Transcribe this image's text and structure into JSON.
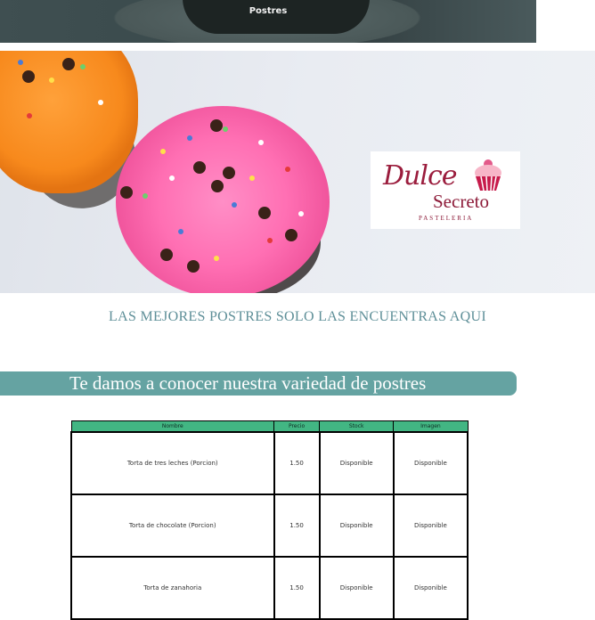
{
  "top_strip": {
    "label": "Postres"
  },
  "hero": {
    "logo": {
      "line1": "Dulce",
      "line2": "Secreto",
      "line3": "PASTELERIA"
    }
  },
  "tagline": "LAS MEJORES POSTRES SOLO LAS ENCUENTRAS AQUI",
  "section": {
    "title": "Te damos a conocer nuestra variedad de postres"
  },
  "table": {
    "headers": [
      "Nombre",
      "Precio",
      "Stock",
      "Imagen"
    ],
    "rows": [
      {
        "nombre": "Torta de tres leches (Porcion)",
        "precio": "1.50",
        "stock": "Disponible",
        "imagen": "Disponible"
      },
      {
        "nombre": "Torta de chocolate (Porcion)",
        "precio": "1.50",
        "stock": "Disponible",
        "imagen": "Disponible"
      },
      {
        "nombre": "Torta de zanahoria",
        "precio": "1.50",
        "stock": "Disponible",
        "imagen": "Disponible"
      }
    ]
  },
  "colors": {
    "accent_teal": "#65a3a2",
    "table_header": "#42b683",
    "tagline": "#5e8f98",
    "logo_brand": "#9b1d3d"
  }
}
